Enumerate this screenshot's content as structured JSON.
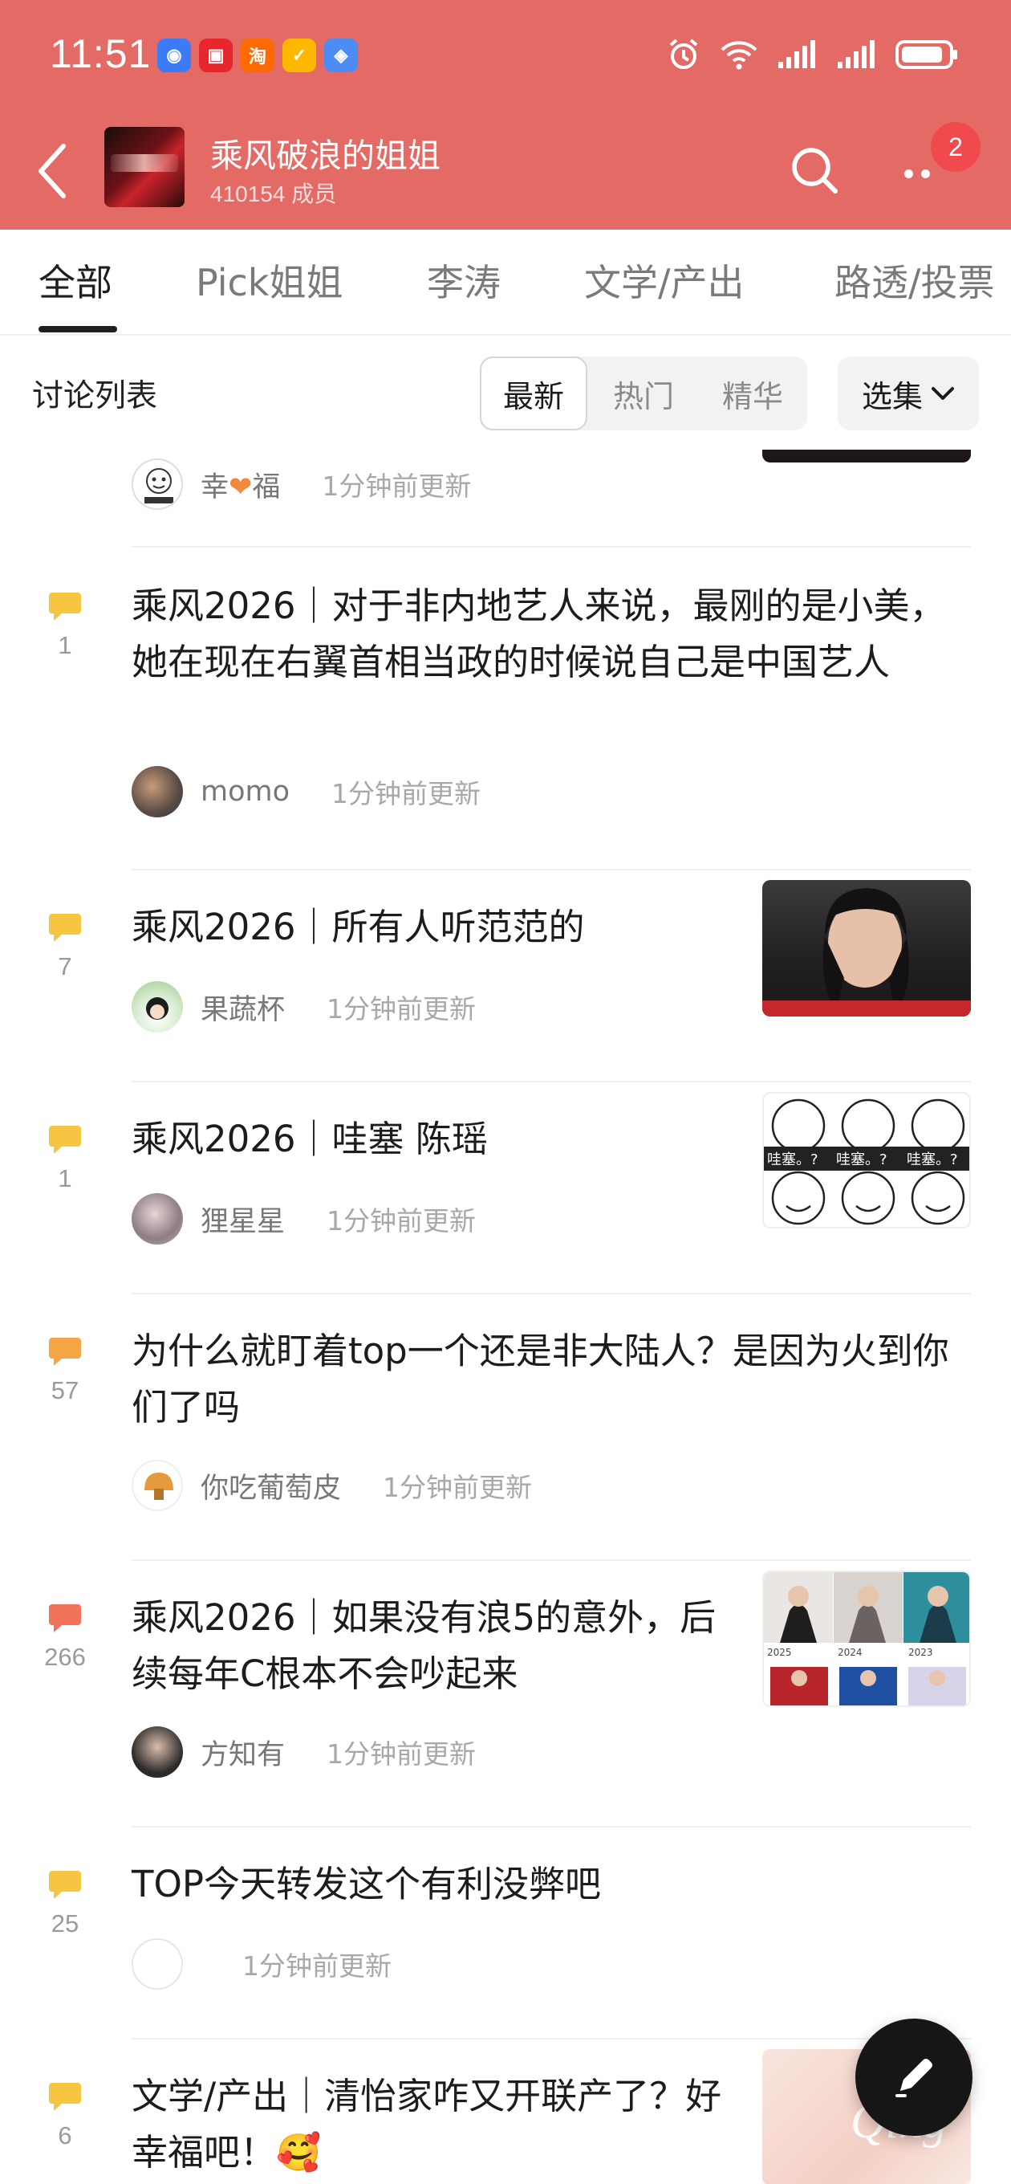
{
  "status_bar": {
    "time": "11:51",
    "notification_apps": [
      {
        "name": "browser-app-icon",
        "color": "#3b7bf7",
        "glyph": "◉"
      },
      {
        "name": "news-app-icon",
        "color": "#e8262d",
        "glyph": "▣"
      },
      {
        "name": "taobao-app-icon",
        "color": "#ff6a00",
        "glyph": "淘"
      },
      {
        "name": "wallet-app-icon",
        "color": "#ffb800",
        "glyph": "✓"
      },
      {
        "name": "photos-app-icon",
        "color": "#4b8cf5",
        "glyph": "◈"
      }
    ]
  },
  "header": {
    "group_name": "乘风破浪的姐姐",
    "member_count": "410154 成员",
    "more_badge": "2"
  },
  "tabs": [
    "全部",
    "Pick姐姐",
    "李涛",
    "文学/产出",
    "路透/投票"
  ],
  "active_tab": 0,
  "sort_bar": {
    "list_title": "讨论列表",
    "options": [
      "最新",
      "热门",
      "精华"
    ],
    "active_option": 0,
    "collection_label": "选集"
  },
  "posts": [
    {
      "comments": "",
      "title": "",
      "author_prefix": "幸",
      "author_suffix": "福",
      "updated": "1分钟前更新"
    },
    {
      "comments": "1",
      "title": "乘风2026｜对于非内地艺人来说，最刚的是小美，她在现在右翼首相当政的时候说自己是中国艺人",
      "author": "momo",
      "updated": "1分钟前更新",
      "icon_color": "#f6c542"
    },
    {
      "comments": "7",
      "title": "乘风2026｜所有人听范范的",
      "author": "果蔬杯",
      "updated": "1分钟前更新",
      "icon_color": "#f6c542"
    },
    {
      "comments": "1",
      "title": "乘风2026｜哇塞 陈瑶",
      "author": "狸星星",
      "updated": "1分钟前更新",
      "icon_color": "#f6c542",
      "thumb_text": "哇塞。?"
    },
    {
      "comments": "57",
      "title": "为什么就盯着top一个还是非大陆人？是因为火到你们了吗",
      "author": "你吃葡萄皮",
      "updated": "1分钟前更新",
      "icon_color": "#f5a544"
    },
    {
      "comments": "266",
      "title": "乘风2026｜如果没有浪5的意外，后续每年C根本不会吵起来",
      "author": "方知有",
      "updated": "1分钟前更新",
      "icon_color": "#f2735a",
      "thumb_years": [
        "2025",
        "2024",
        "2023"
      ]
    },
    {
      "comments": "25",
      "title": "TOP今天转发这个有利没弊吧",
      "author": "",
      "updated": "1分钟前更新",
      "icon_color": "#f6c542"
    },
    {
      "comments": "6",
      "title": "文学/产出｜清怡家咋又开联产了？好幸福吧！🥰",
      "author": "",
      "updated": "",
      "icon_color": "#f6c542",
      "thumb_text": "Qing"
    }
  ]
}
